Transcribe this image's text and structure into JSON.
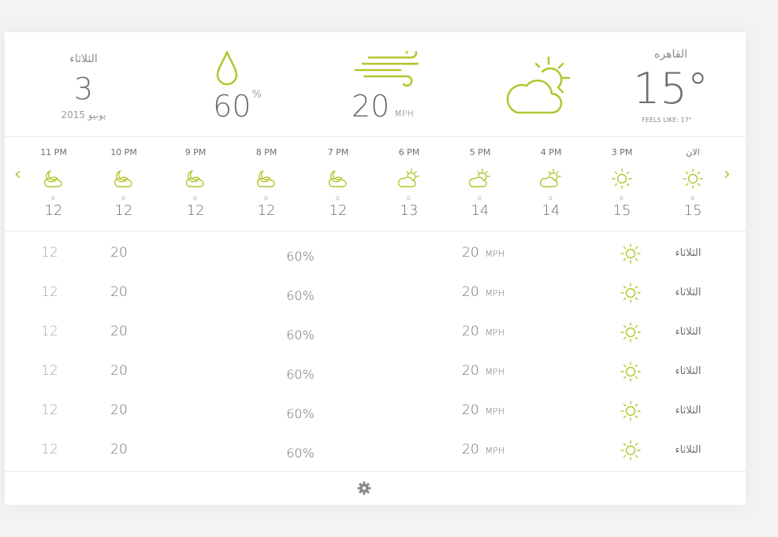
{
  "header": {
    "day_of_week": "الثلاثاء",
    "day_number": "3",
    "month_year": "يونيو 2015",
    "humidity_value": "60",
    "humidity_unit": "%",
    "wind_value": "20",
    "wind_unit": "MPH",
    "weather_icon": "partly-cloudy-icon",
    "city": "القاهره",
    "temperature": "15°",
    "feels_like": "FEELS LIKE: 17°"
  },
  "hourly": [
    {
      "time": "الان",
      "icon": "sun-icon",
      "temp": "15"
    },
    {
      "time": "3 PM",
      "icon": "sun-icon",
      "temp": "15"
    },
    {
      "time": "4 PM",
      "icon": "sun-cloud-icon",
      "temp": "14"
    },
    {
      "time": "5 PM",
      "icon": "sun-cloud-icon",
      "temp": "14"
    },
    {
      "time": "6 PM",
      "icon": "sun-cloud-icon",
      "temp": "13"
    },
    {
      "time": "7 PM",
      "icon": "moon-cloud-icon",
      "temp": "12"
    },
    {
      "time": "8 PM",
      "icon": "moon-cloud-icon",
      "temp": "12"
    },
    {
      "time": "9 PM",
      "icon": "moon-cloud-icon",
      "temp": "12"
    },
    {
      "time": "10 PM",
      "icon": "moon-cloud-icon",
      "temp": "12"
    },
    {
      "time": "11 PM",
      "icon": "moon-cloud-icon",
      "temp": "12"
    }
  ],
  "daily": [
    {
      "day": "الثلاثاء",
      "icon": "sun-icon",
      "wind": "20",
      "wind_unit": "MPH",
      "humidity": "60%",
      "high": "20",
      "low": "12"
    },
    {
      "day": "الثلاثاء",
      "icon": "sun-icon",
      "wind": "20",
      "wind_unit": "MPH",
      "humidity": "60%",
      "high": "20",
      "low": "12"
    },
    {
      "day": "الثلاثاء",
      "icon": "sun-icon",
      "wind": "20",
      "wind_unit": "MPH",
      "humidity": "60%",
      "high": "20",
      "low": "12"
    },
    {
      "day": "الثلاثاء",
      "icon": "sun-icon",
      "wind": "20",
      "wind_unit": "MPH",
      "humidity": "60%",
      "high": "20",
      "low": "12"
    },
    {
      "day": "الثلاثاء",
      "icon": "sun-icon",
      "wind": "20",
      "wind_unit": "MPH",
      "humidity": "60%",
      "high": "20",
      "low": "12"
    },
    {
      "day": "الثلاثاء",
      "icon": "sun-icon",
      "wind": "20",
      "wind_unit": "MPH",
      "humidity": "60%",
      "high": "20",
      "low": "12"
    }
  ],
  "nav": {
    "prev_icon": "chevron-left-icon",
    "next_icon": "chevron-right-icon"
  },
  "footer": {
    "settings_icon": "gear-icon"
  },
  "colors": {
    "accent": "#b3c52c",
    "text": "#6e6e6e",
    "muted": "#a5a5a5",
    "divider": "#e8e8e8",
    "background": "#f3f3f3"
  }
}
